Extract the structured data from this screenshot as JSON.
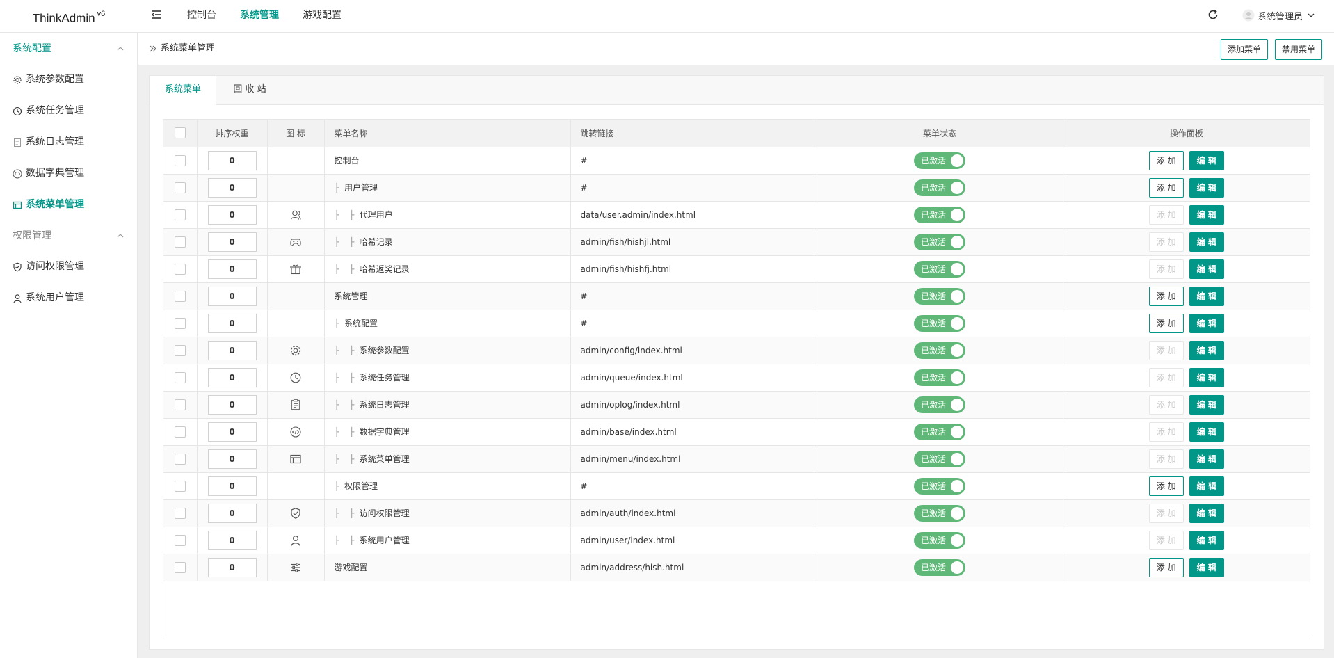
{
  "app": {
    "name": "ThinkAdmin",
    "version": "v6"
  },
  "topnav": [
    {
      "label": "控制台",
      "active": false
    },
    {
      "label": "系统管理",
      "active": true
    },
    {
      "label": "游戏配置",
      "active": false
    }
  ],
  "user": {
    "name": "系统管理员"
  },
  "sidebar": {
    "groups": [
      {
        "title": "系统配置",
        "active": true,
        "items": [
          {
            "label": "系统参数配置",
            "icon": "gear-icon",
            "active": false
          },
          {
            "label": "系统任务管理",
            "icon": "clock-icon",
            "active": false
          },
          {
            "label": "系统日志管理",
            "icon": "log-icon",
            "active": false
          },
          {
            "label": "数据字典管理",
            "icon": "code-icon",
            "active": false
          },
          {
            "label": "系统菜单管理",
            "icon": "menu-icon",
            "active": true
          }
        ]
      },
      {
        "title": "权限管理",
        "active": false,
        "items": [
          {
            "label": "访问权限管理",
            "icon": "shield-icon",
            "active": false
          },
          {
            "label": "系统用户管理",
            "icon": "user-icon",
            "active": false
          }
        ]
      }
    ]
  },
  "header": {
    "breadcrumb": "系统菜单管理",
    "add_button": "添加菜单",
    "disable_button": "禁用菜单"
  },
  "tabs": [
    {
      "label": "系统菜单",
      "active": true
    },
    {
      "label": "回 收 站",
      "active": false
    }
  ],
  "table": {
    "headers": {
      "sort": "排序权重",
      "icon": "图 标",
      "title": "菜单名称",
      "url": "跳转链接",
      "status": "菜单状态",
      "actions": "操作面板"
    },
    "status_label": "已激活",
    "add_label": "添 加",
    "edit_label": "编 辑",
    "rows": [
      {
        "sort": "0",
        "icon": "",
        "prefix": "",
        "title": "控制台",
        "url": "#",
        "can_add": true
      },
      {
        "sort": "0",
        "icon": "",
        "prefix": "├ ",
        "title": "用户管理",
        "url": "#",
        "can_add": true
      },
      {
        "sort": "0",
        "icon": "user-group-icon",
        "prefix": "├  ├ ",
        "title": "代理用户",
        "url": "data/user.admin/index.html",
        "can_add": false
      },
      {
        "sort": "0",
        "icon": "gamepad-icon",
        "prefix": "├  ├ ",
        "title": "哈希记录",
        "url": "admin/fish/hishjl.html",
        "can_add": false
      },
      {
        "sort": "0",
        "icon": "gift-icon",
        "prefix": "├  ├ ",
        "title": "哈希返奖记录",
        "url": "admin/fish/hishfj.html",
        "can_add": false
      },
      {
        "sort": "0",
        "icon": "",
        "prefix": "",
        "title": "系统管理",
        "url": "#",
        "can_add": true
      },
      {
        "sort": "0",
        "icon": "",
        "prefix": "├ ",
        "title": "系统配置",
        "url": "#",
        "can_add": true
      },
      {
        "sort": "0",
        "icon": "gear-icon",
        "prefix": "├  ├ ",
        "title": "系统参数配置",
        "url": "admin/config/index.html",
        "can_add": false
      },
      {
        "sort": "0",
        "icon": "clock-icon",
        "prefix": "├  ├ ",
        "title": "系统任务管理",
        "url": "admin/queue/index.html",
        "can_add": false
      },
      {
        "sort": "0",
        "icon": "log-icon",
        "prefix": "├  ├ ",
        "title": "系统日志管理",
        "url": "admin/oplog/index.html",
        "can_add": false
      },
      {
        "sort": "0",
        "icon": "code-icon",
        "prefix": "├  ├ ",
        "title": "数据字典管理",
        "url": "admin/base/index.html",
        "can_add": false
      },
      {
        "sort": "0",
        "icon": "menu-icon",
        "prefix": "├  ├ ",
        "title": "系统菜单管理",
        "url": "admin/menu/index.html",
        "can_add": false
      },
      {
        "sort": "0",
        "icon": "",
        "prefix": "├ ",
        "title": "权限管理",
        "url": "#",
        "can_add": true
      },
      {
        "sort": "0",
        "icon": "shield-icon",
        "prefix": "├  ├ ",
        "title": "访问权限管理",
        "url": "admin/auth/index.html",
        "can_add": false
      },
      {
        "sort": "0",
        "icon": "user-icon",
        "prefix": "├  ├ ",
        "title": "系统用户管理",
        "url": "admin/user/index.html",
        "can_add": false
      },
      {
        "sort": "0",
        "icon": "sliders-icon",
        "prefix": "",
        "title": "游戏配置",
        "url": "admin/address/hish.html",
        "can_add": true
      }
    ]
  },
  "colors": {
    "primary": "#009688",
    "switch_on": "#5FB878"
  }
}
